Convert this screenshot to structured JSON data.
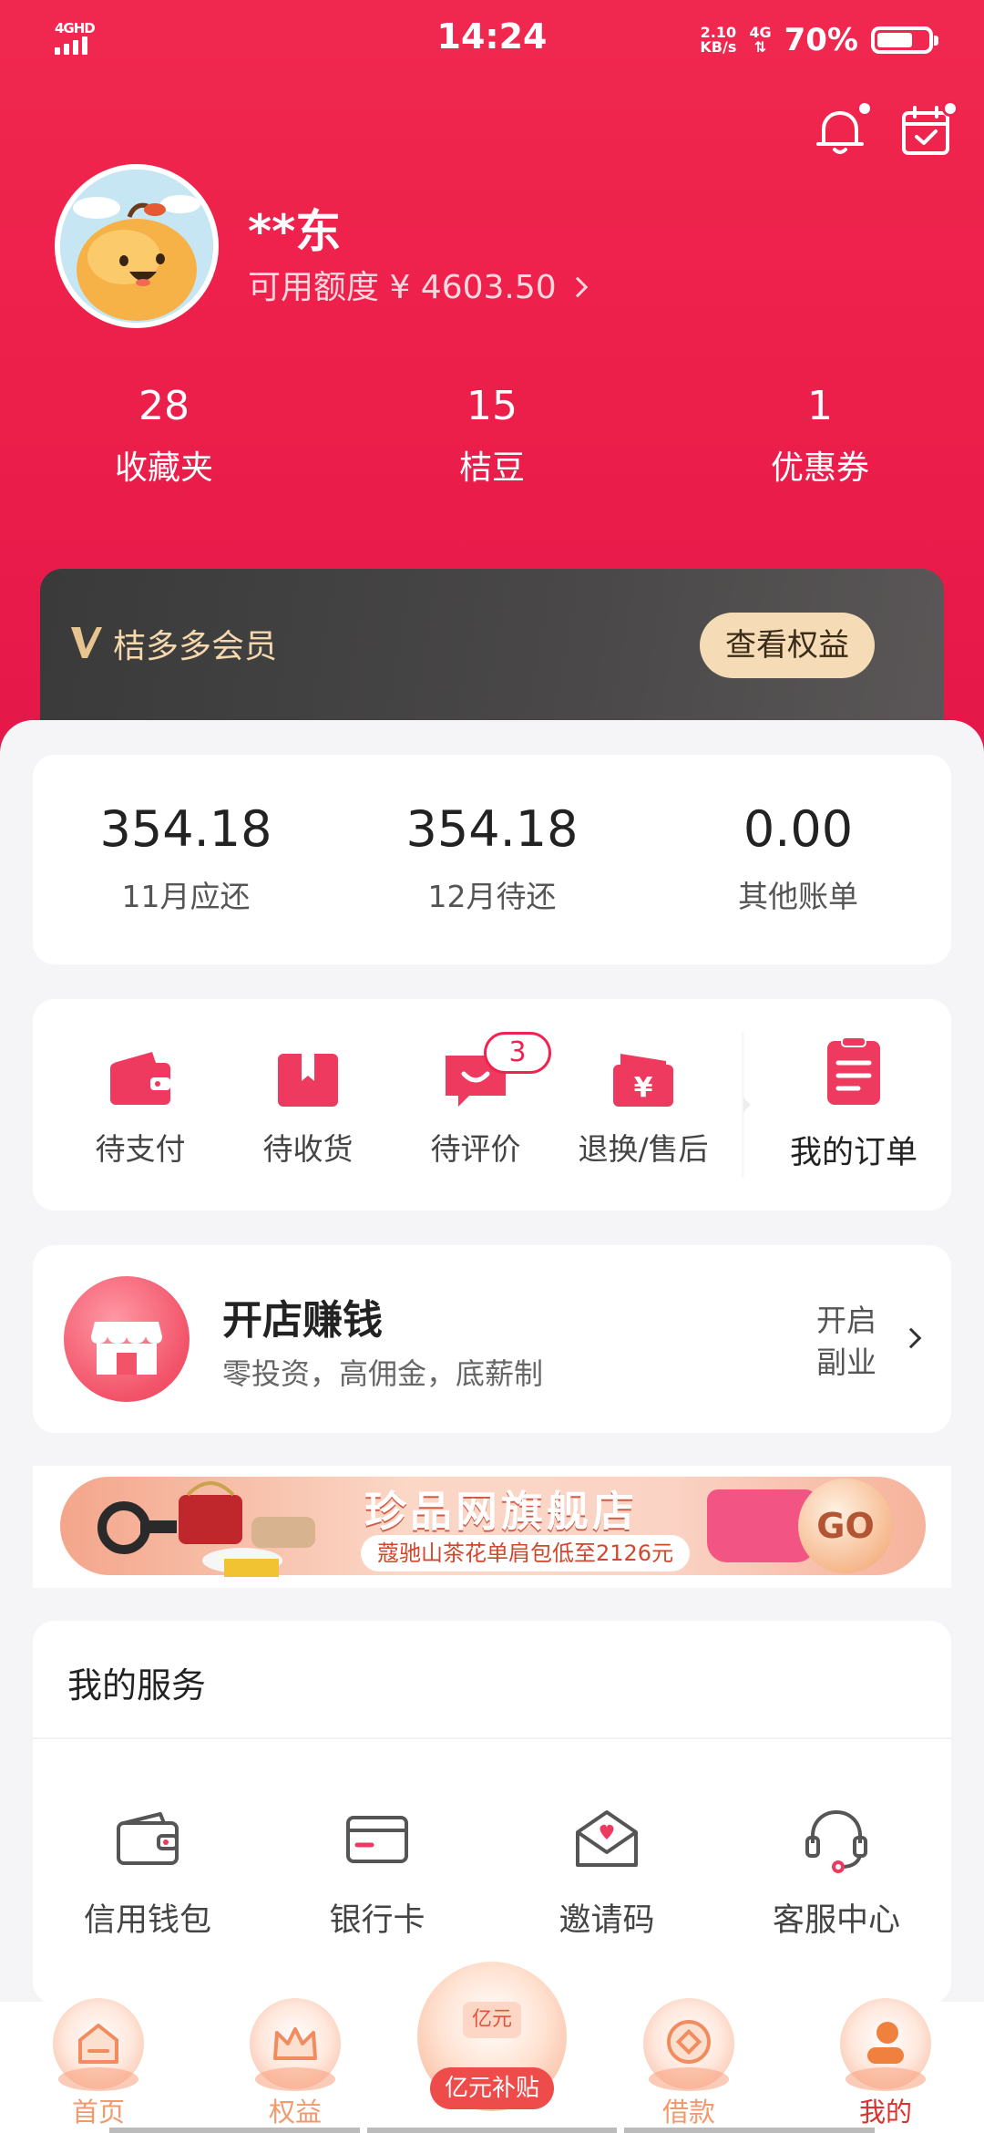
{
  "status_bar": {
    "network": "4GHD",
    "time": "14:24",
    "speed_value": "2.10",
    "speed_unit": "KB/s",
    "cell": "4G",
    "battery": "70%",
    "battery_level": 0.7
  },
  "header": {
    "notification_icon": "bell-icon",
    "calendar_icon": "calendar-check-icon"
  },
  "profile": {
    "username": "**东",
    "credit_text": "可用额度 ¥ 4603.50"
  },
  "stats": [
    {
      "value": "28",
      "label": "收藏夹"
    },
    {
      "value": "15",
      "label": "桔豆"
    },
    {
      "value": "1",
      "label": "优惠券"
    }
  ],
  "vip": {
    "title": "桔多多会员",
    "button": "查看权益"
  },
  "bills": [
    {
      "amount": "354.18",
      "label": "11月应还"
    },
    {
      "amount": "354.18",
      "label": "12月待还"
    },
    {
      "amount": "0.00",
      "label": "其他账单"
    }
  ],
  "orders": {
    "items": [
      {
        "label": "待支付",
        "icon": "wallet-icon"
      },
      {
        "label": "待收货",
        "icon": "package-icon"
      },
      {
        "label": "待评价",
        "icon": "comment-icon",
        "badge": "3"
      },
      {
        "label": "退换/售后",
        "icon": "refund-icon"
      }
    ],
    "my_orders": "我的订单"
  },
  "shop": {
    "title": "开店赚钱",
    "subtitle": "零投资，高佣金，底薪制",
    "link_line1": "开启",
    "link_line2": "副业"
  },
  "banner": {
    "title": "珍品网旗舰店",
    "subtitle": "蔻驰山茶花单肩包低至2126元",
    "go": "GO"
  },
  "services": {
    "title": "我的服务",
    "items": [
      {
        "label": "信用钱包",
        "icon": "wallet-outline-icon"
      },
      {
        "label": "银行卡",
        "icon": "bank-card-icon"
      },
      {
        "label": "邀请码",
        "icon": "invite-envelope-icon"
      },
      {
        "label": "客服中心",
        "icon": "headset-icon"
      }
    ]
  },
  "tabbar": {
    "tabs": [
      {
        "label": "首页",
        "icon": "home-icon"
      },
      {
        "label": "权益",
        "icon": "crown-icon"
      },
      {
        "label": "借款",
        "icon": "coin-icon"
      },
      {
        "label": "我的",
        "icon": "user-icon"
      }
    ],
    "center_coin": "亿元",
    "center_label": "亿元补贴",
    "active": "我的"
  },
  "colors": {
    "brand": "#ec1e4a",
    "vip_gold": "#f5dcb7",
    "tab_inactive": "#f09a6d",
    "tab_active": "#d8332e"
  }
}
